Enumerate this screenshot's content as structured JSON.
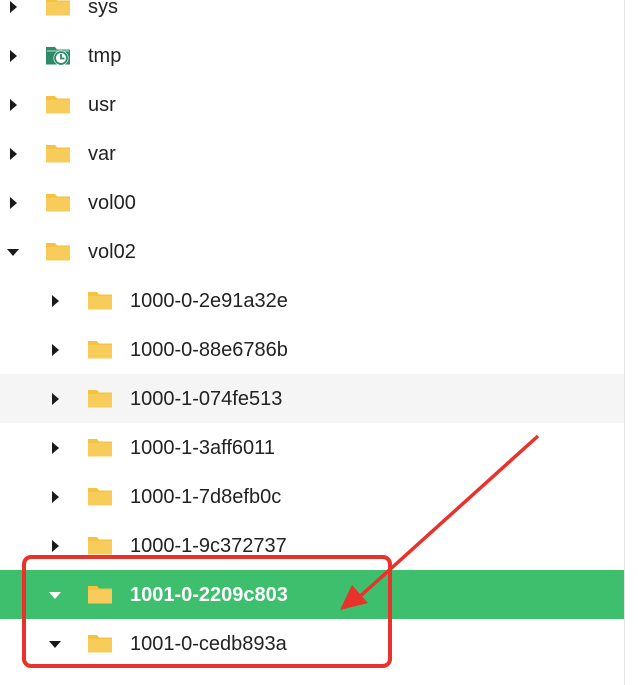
{
  "tree": {
    "items": [
      {
        "label": "sys",
        "expanded": false,
        "icon": "folder-icon",
        "depth": 0
      },
      {
        "label": "tmp",
        "expanded": false,
        "icon": "clock-folder-icon",
        "depth": 0
      },
      {
        "label": "usr",
        "expanded": false,
        "icon": "folder-icon",
        "depth": 0
      },
      {
        "label": "var",
        "expanded": false,
        "icon": "folder-icon",
        "depth": 0
      },
      {
        "label": "vol00",
        "expanded": false,
        "icon": "folder-icon",
        "depth": 0
      },
      {
        "label": "vol02",
        "expanded": true,
        "icon": "folder-icon",
        "depth": 0
      },
      {
        "label": "1000-0-2e91a32e",
        "expanded": false,
        "icon": "folder-icon",
        "depth": 1
      },
      {
        "label": "1000-0-88e6786b",
        "expanded": false,
        "icon": "folder-icon",
        "depth": 1
      },
      {
        "label": "1000-1-074fe513",
        "expanded": false,
        "icon": "folder-icon",
        "depth": 1,
        "state": "hover"
      },
      {
        "label": "1000-1-3aff6011",
        "expanded": false,
        "icon": "folder-icon",
        "depth": 1
      },
      {
        "label": "1000-1-7d8efb0c",
        "expanded": false,
        "icon": "folder-icon",
        "depth": 1
      },
      {
        "label": "1000-1-9c372737",
        "expanded": false,
        "icon": "folder-icon",
        "depth": 1
      },
      {
        "label": "1001-0-2209c803",
        "expanded": true,
        "icon": "folder-icon",
        "depth": 1,
        "state": "selected"
      },
      {
        "label": "1001-0-cedb893a",
        "expanded": true,
        "icon": "folder-icon",
        "depth": 1
      }
    ]
  },
  "colors": {
    "selected_bg": "#3dbf6e",
    "hover_bg": "#f5f5f5",
    "folder": "#f5c242",
    "tmp_icon": "#2e8b6a",
    "annotation": "#e8322b",
    "text": "#222222"
  }
}
